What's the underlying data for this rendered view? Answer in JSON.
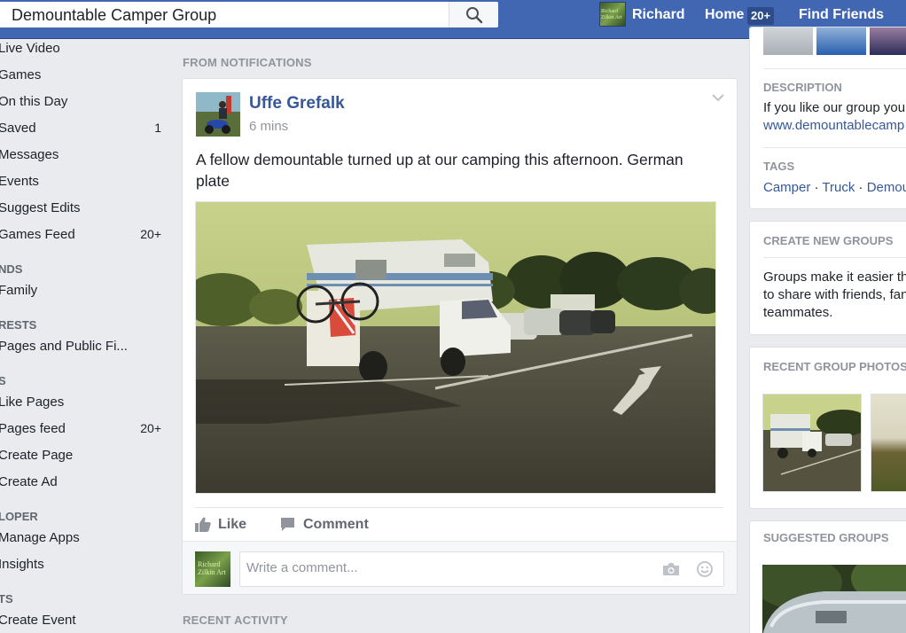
{
  "topbar": {
    "search_value": "Demountable Camper Group",
    "user_name": "Richard",
    "home_label": "Home",
    "home_badge": "20+",
    "find_friends_label": "Find Friends",
    "avatar_text": "Richard Zilkin Art"
  },
  "sidebar": {
    "items": [
      {
        "label": "Live Video",
        "count": ""
      },
      {
        "label": "Games",
        "count": ""
      },
      {
        "label": "On this Day",
        "count": ""
      },
      {
        "label": "Saved",
        "count": "1"
      },
      {
        "label": "Messages",
        "count": ""
      },
      {
        "label": "Events",
        "count": ""
      },
      {
        "label": "Suggest Edits",
        "count": ""
      },
      {
        "label": "Games Feed",
        "count": "20+"
      },
      {
        "label": "Family",
        "count": ""
      },
      {
        "label": "Pages and Public Fi...",
        "count": ""
      },
      {
        "label": "Like Pages",
        "count": ""
      },
      {
        "label": "Pages feed",
        "count": "20+"
      },
      {
        "label": "Create Page",
        "count": ""
      },
      {
        "label": "Create Ad",
        "count": ""
      },
      {
        "label": "Manage Apps",
        "count": ""
      },
      {
        "label": "Insights",
        "count": ""
      },
      {
        "label": "Create Event",
        "count": ""
      }
    ],
    "headers": [
      "NDS",
      "RESTS",
      "S",
      "LOPER",
      "TS"
    ]
  },
  "feed": {
    "from_notifications_label": "FROM NOTIFICATIONS",
    "recent_activity_label": "RECENT ACTIVITY",
    "post": {
      "author": "Uffe Grefalk",
      "time": "6 mins",
      "text": "A fellow demountable turned up at our camping this afternoon. German plate",
      "like_label": "Like",
      "comment_label": "Comment",
      "comment_placeholder": "Write a comment..."
    }
  },
  "right": {
    "description_label": "DESCRIPTION",
    "description_text": "If you like our group you",
    "description_link": "www.demountablecamp",
    "tags_label": "TAGS",
    "tags": [
      "Camper",
      "Truck",
      "Demou"
    ],
    "tag_separator": " · ",
    "create_groups_label": "CREATE NEW GROUPS",
    "create_groups_text": [
      "Groups make it easier th",
      "to share with friends, fan",
      "teammates."
    ],
    "recent_photos_label": "RECENT GROUP PHOTOS",
    "suggested_groups_label": "SUGGESTED GROUPS"
  },
  "colors": {
    "topbar": "#4267b2",
    "link": "#365899",
    "background": "#e9ebee"
  }
}
